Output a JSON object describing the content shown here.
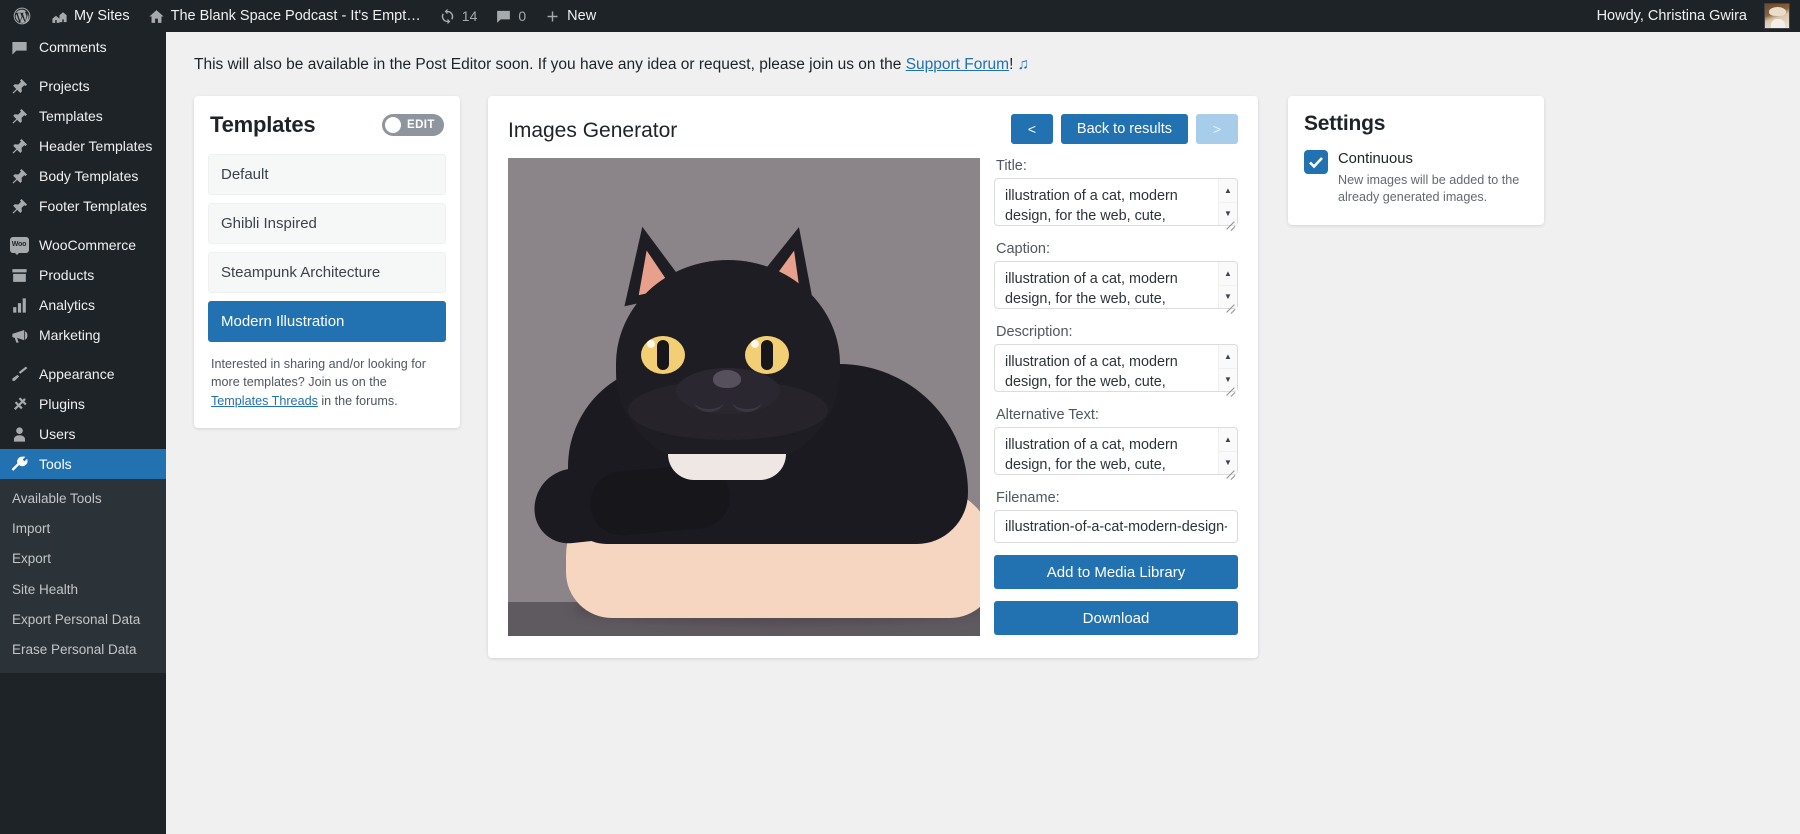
{
  "adminbar": {
    "wp_logo": "wordpress-icon",
    "my_sites": "My Sites",
    "site_name": "The Blank Space Podcast - It's Empt…",
    "updates_count": "14",
    "comments_count": "0",
    "new_label": "New",
    "howdy": "Howdy, Christina Gwira"
  },
  "sidebar": {
    "items": [
      {
        "label": "Comments",
        "icon": "comments-icon"
      },
      {
        "label": "Projects",
        "icon": "pin-icon"
      },
      {
        "label": "Templates",
        "icon": "pin-icon"
      },
      {
        "label": "Header Templates",
        "icon": "pin-icon"
      },
      {
        "label": "Body Templates",
        "icon": "pin-icon"
      },
      {
        "label": "Footer Templates",
        "icon": "pin-icon"
      },
      {
        "label": "WooCommerce",
        "icon": "woo-icon"
      },
      {
        "label": "Products",
        "icon": "products-icon"
      },
      {
        "label": "Analytics",
        "icon": "chart-icon"
      },
      {
        "label": "Marketing",
        "icon": "megaphone-icon"
      },
      {
        "label": "Appearance",
        "icon": "brush-icon"
      },
      {
        "label": "Plugins",
        "icon": "plug-icon"
      },
      {
        "label": "Users",
        "icon": "user-icon"
      },
      {
        "label": "Tools",
        "icon": "wrench-icon"
      }
    ],
    "current": "Tools",
    "submenu": [
      "Available Tools",
      "Import",
      "Export",
      "Site Health",
      "Export Personal Data",
      "Erase Personal Data"
    ]
  },
  "notice": {
    "text_before": "This will also be available in the Post Editor soon. If you have any idea or request, please join us on the ",
    "link": "Support Forum",
    "text_after": "!",
    "emoji": "♫"
  },
  "templates_panel": {
    "title": "Templates",
    "edit_toggle_label": "EDIT",
    "items": [
      "Default",
      "Ghibli Inspired",
      "Steampunk Architecture",
      "Modern Illustration"
    ],
    "active": "Modern Illustration",
    "note_before": "Interested in sharing and/or looking for more templates? Join us on the ",
    "note_link": "Templates Threads",
    "note_after": " in the forums."
  },
  "generator": {
    "title": "Images Generator",
    "prev_label": "<",
    "back_label": "Back to results",
    "next_label": ">",
    "fields": {
      "title_label": "Title:",
      "title_value": "illustration of a cat, modern design, for the web, cute, happy, minimalistic, clean background",
      "caption_label": "Caption:",
      "caption_value": "illustration of a cat, modern design, for the web, cute, happy, minimalistic, clean background",
      "description_label": "Description:",
      "description_value": "illustration of a cat, modern design, for the web, cute, happy, minimalistic, clean background",
      "alt_label": "Alternative Text:",
      "alt_value": "illustration of a cat, modern design, for the web, cute, happy, minimalistic, clean background",
      "filename_label": "Filename:",
      "filename_value": "illustration-of-a-cat-modern-design-"
    },
    "add_to_media_label": "Add to Media Library",
    "download_label": "Download",
    "preview_alt": "generated-cat-illustration"
  },
  "settings_panel": {
    "title": "Settings",
    "continuous_label": "Continuous",
    "continuous_desc": "New images will be added to the already generated images.",
    "continuous_checked": true
  },
  "colors": {
    "accent": "#2271b1",
    "admin_bg": "#1d2327",
    "submenu_bg": "#2c3338",
    "page_bg": "#f0f0f1"
  }
}
